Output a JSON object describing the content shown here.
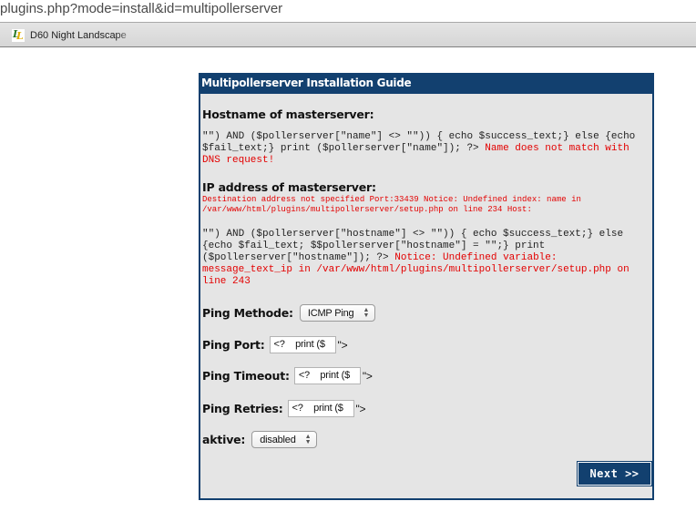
{
  "browser": {
    "url": "plugins.php?mode=install&id=multipollerserver",
    "bookmarks": [
      {
        "label": "D60 Night Landscape",
        "icon": "ll-favicon"
      }
    ]
  },
  "panel": {
    "title": "Multipollerserver Installation Guide",
    "hostname_section": {
      "title": "Hostname of masterserver:",
      "code": "\"\") AND ($pollerserver[\"name\"] <> \"\")) { echo $success_text;} else {echo $fail_text;} print ($pollerserver[\"name\"]); ?>",
      "error": "Name does not match with DNS request!"
    },
    "ip_section": {
      "title": "IP address of masterserver:",
      "notice": "Destination address not specified Port:33439 Notice: Undefined index: name in /var/www/html/plugins/multipollerserver/setup.php on line 234 Host:",
      "code": "\"\") AND ($pollerserver[\"hostname\"] <> \"\")) { echo $success_text;} else {echo $fail_text; $$pollerserver[\"hostname\"] = \"\";} print ($pollerserver[\"hostname\"]); ?>",
      "error": "Notice: Undefined variable: message_text_ip in /var/www/html/plugins/multipollerserver/setup.php on line 243"
    },
    "fields": {
      "ping_method": {
        "label": "Ping Methode:",
        "value": "ICMP Ping"
      },
      "ping_port": {
        "label": "Ping Port:",
        "value": "<?    print ($",
        "suffix": "\">"
      },
      "ping_timeout": {
        "label": "Ping Timeout:",
        "value": "<?    print ($",
        "suffix": "\">"
      },
      "ping_retries": {
        "label": "Ping Retries:",
        "value": "<?    print ($",
        "suffix": "\">"
      },
      "aktive": {
        "label": "aktive:",
        "value": "disabled"
      }
    },
    "next_label": "Next >>"
  },
  "colors": {
    "header_bg": "#12406f",
    "panel_bg": "#e5e5e5",
    "error_text": "#e30000"
  }
}
